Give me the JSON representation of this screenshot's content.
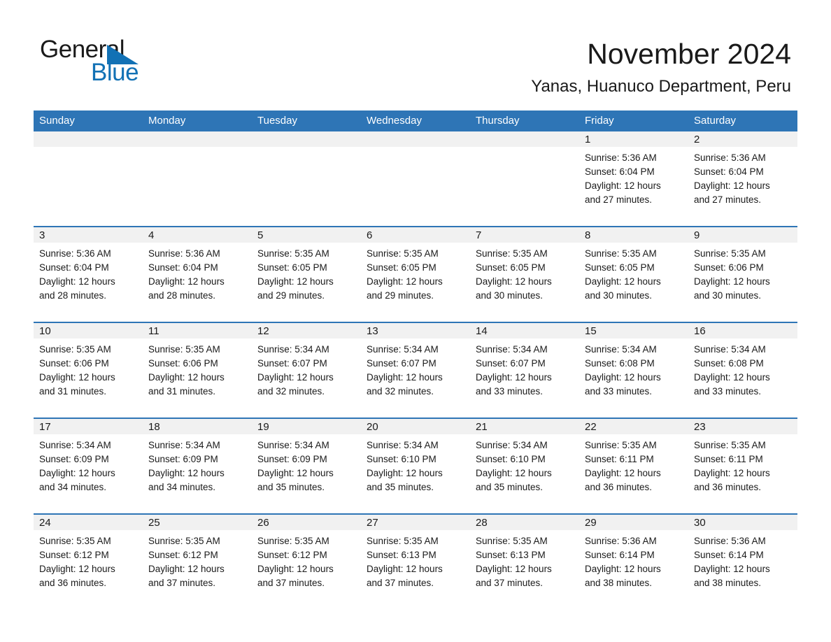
{
  "brand": {
    "name_part1": "General",
    "name_part2": "Blue",
    "accent_color": "#1271b5"
  },
  "header": {
    "month_title": "November 2024",
    "location": "Yanas, Huanuco Department, Peru"
  },
  "calendar": {
    "header_bg": "#2e75b6",
    "date_band_bg": "#f1f1f1",
    "weekdays": [
      "Sunday",
      "Monday",
      "Tuesday",
      "Wednesday",
      "Thursday",
      "Friday",
      "Saturday"
    ],
    "weeks": [
      [
        {
          "empty": true
        },
        {
          "empty": true
        },
        {
          "empty": true
        },
        {
          "empty": true
        },
        {
          "empty": true
        },
        {
          "day": "1",
          "sunrise": "Sunrise: 5:36 AM",
          "sunset": "Sunset: 6:04 PM",
          "daylight_line1": "Daylight: 12 hours",
          "daylight_line2": "and 27 minutes."
        },
        {
          "day": "2",
          "sunrise": "Sunrise: 5:36 AM",
          "sunset": "Sunset: 6:04 PM",
          "daylight_line1": "Daylight: 12 hours",
          "daylight_line2": "and 27 minutes."
        }
      ],
      [
        {
          "day": "3",
          "sunrise": "Sunrise: 5:36 AM",
          "sunset": "Sunset: 6:04 PM",
          "daylight_line1": "Daylight: 12 hours",
          "daylight_line2": "and 28 minutes."
        },
        {
          "day": "4",
          "sunrise": "Sunrise: 5:36 AM",
          "sunset": "Sunset: 6:04 PM",
          "daylight_line1": "Daylight: 12 hours",
          "daylight_line2": "and 28 minutes."
        },
        {
          "day": "5",
          "sunrise": "Sunrise: 5:35 AM",
          "sunset": "Sunset: 6:05 PM",
          "daylight_line1": "Daylight: 12 hours",
          "daylight_line2": "and 29 minutes."
        },
        {
          "day": "6",
          "sunrise": "Sunrise: 5:35 AM",
          "sunset": "Sunset: 6:05 PM",
          "daylight_line1": "Daylight: 12 hours",
          "daylight_line2": "and 29 minutes."
        },
        {
          "day": "7",
          "sunrise": "Sunrise: 5:35 AM",
          "sunset": "Sunset: 6:05 PM",
          "daylight_line1": "Daylight: 12 hours",
          "daylight_line2": "and 30 minutes."
        },
        {
          "day": "8",
          "sunrise": "Sunrise: 5:35 AM",
          "sunset": "Sunset: 6:05 PM",
          "daylight_line1": "Daylight: 12 hours",
          "daylight_line2": "and 30 minutes."
        },
        {
          "day": "9",
          "sunrise": "Sunrise: 5:35 AM",
          "sunset": "Sunset: 6:06 PM",
          "daylight_line1": "Daylight: 12 hours",
          "daylight_line2": "and 30 minutes."
        }
      ],
      [
        {
          "day": "10",
          "sunrise": "Sunrise: 5:35 AM",
          "sunset": "Sunset: 6:06 PM",
          "daylight_line1": "Daylight: 12 hours",
          "daylight_line2": "and 31 minutes."
        },
        {
          "day": "11",
          "sunrise": "Sunrise: 5:35 AM",
          "sunset": "Sunset: 6:06 PM",
          "daylight_line1": "Daylight: 12 hours",
          "daylight_line2": "and 31 minutes."
        },
        {
          "day": "12",
          "sunrise": "Sunrise: 5:34 AM",
          "sunset": "Sunset: 6:07 PM",
          "daylight_line1": "Daylight: 12 hours",
          "daylight_line2": "and 32 minutes."
        },
        {
          "day": "13",
          "sunrise": "Sunrise: 5:34 AM",
          "sunset": "Sunset: 6:07 PM",
          "daylight_line1": "Daylight: 12 hours",
          "daylight_line2": "and 32 minutes."
        },
        {
          "day": "14",
          "sunrise": "Sunrise: 5:34 AM",
          "sunset": "Sunset: 6:07 PM",
          "daylight_line1": "Daylight: 12 hours",
          "daylight_line2": "and 33 minutes."
        },
        {
          "day": "15",
          "sunrise": "Sunrise: 5:34 AM",
          "sunset": "Sunset: 6:08 PM",
          "daylight_line1": "Daylight: 12 hours",
          "daylight_line2": "and 33 minutes."
        },
        {
          "day": "16",
          "sunrise": "Sunrise: 5:34 AM",
          "sunset": "Sunset: 6:08 PM",
          "daylight_line1": "Daylight: 12 hours",
          "daylight_line2": "and 33 minutes."
        }
      ],
      [
        {
          "day": "17",
          "sunrise": "Sunrise: 5:34 AM",
          "sunset": "Sunset: 6:09 PM",
          "daylight_line1": "Daylight: 12 hours",
          "daylight_line2": "and 34 minutes."
        },
        {
          "day": "18",
          "sunrise": "Sunrise: 5:34 AM",
          "sunset": "Sunset: 6:09 PM",
          "daylight_line1": "Daylight: 12 hours",
          "daylight_line2": "and 34 minutes."
        },
        {
          "day": "19",
          "sunrise": "Sunrise: 5:34 AM",
          "sunset": "Sunset: 6:09 PM",
          "daylight_line1": "Daylight: 12 hours",
          "daylight_line2": "and 35 minutes."
        },
        {
          "day": "20",
          "sunrise": "Sunrise: 5:34 AM",
          "sunset": "Sunset: 6:10 PM",
          "daylight_line1": "Daylight: 12 hours",
          "daylight_line2": "and 35 minutes."
        },
        {
          "day": "21",
          "sunrise": "Sunrise: 5:34 AM",
          "sunset": "Sunset: 6:10 PM",
          "daylight_line1": "Daylight: 12 hours",
          "daylight_line2": "and 35 minutes."
        },
        {
          "day": "22",
          "sunrise": "Sunrise: 5:35 AM",
          "sunset": "Sunset: 6:11 PM",
          "daylight_line1": "Daylight: 12 hours",
          "daylight_line2": "and 36 minutes."
        },
        {
          "day": "23",
          "sunrise": "Sunrise: 5:35 AM",
          "sunset": "Sunset: 6:11 PM",
          "daylight_line1": "Daylight: 12 hours",
          "daylight_line2": "and 36 minutes."
        }
      ],
      [
        {
          "day": "24",
          "sunrise": "Sunrise: 5:35 AM",
          "sunset": "Sunset: 6:12 PM",
          "daylight_line1": "Daylight: 12 hours",
          "daylight_line2": "and 36 minutes."
        },
        {
          "day": "25",
          "sunrise": "Sunrise: 5:35 AM",
          "sunset": "Sunset: 6:12 PM",
          "daylight_line1": "Daylight: 12 hours",
          "daylight_line2": "and 37 minutes."
        },
        {
          "day": "26",
          "sunrise": "Sunrise: 5:35 AM",
          "sunset": "Sunset: 6:12 PM",
          "daylight_line1": "Daylight: 12 hours",
          "daylight_line2": "and 37 minutes."
        },
        {
          "day": "27",
          "sunrise": "Sunrise: 5:35 AM",
          "sunset": "Sunset: 6:13 PM",
          "daylight_line1": "Daylight: 12 hours",
          "daylight_line2": "and 37 minutes."
        },
        {
          "day": "28",
          "sunrise": "Sunrise: 5:35 AM",
          "sunset": "Sunset: 6:13 PM",
          "daylight_line1": "Daylight: 12 hours",
          "daylight_line2": "and 37 minutes."
        },
        {
          "day": "29",
          "sunrise": "Sunrise: 5:36 AM",
          "sunset": "Sunset: 6:14 PM",
          "daylight_line1": "Daylight: 12 hours",
          "daylight_line2": "and 38 minutes."
        },
        {
          "day": "30",
          "sunrise": "Sunrise: 5:36 AM",
          "sunset": "Sunset: 6:14 PM",
          "daylight_line1": "Daylight: 12 hours",
          "daylight_line2": "and 38 minutes."
        }
      ]
    ]
  }
}
